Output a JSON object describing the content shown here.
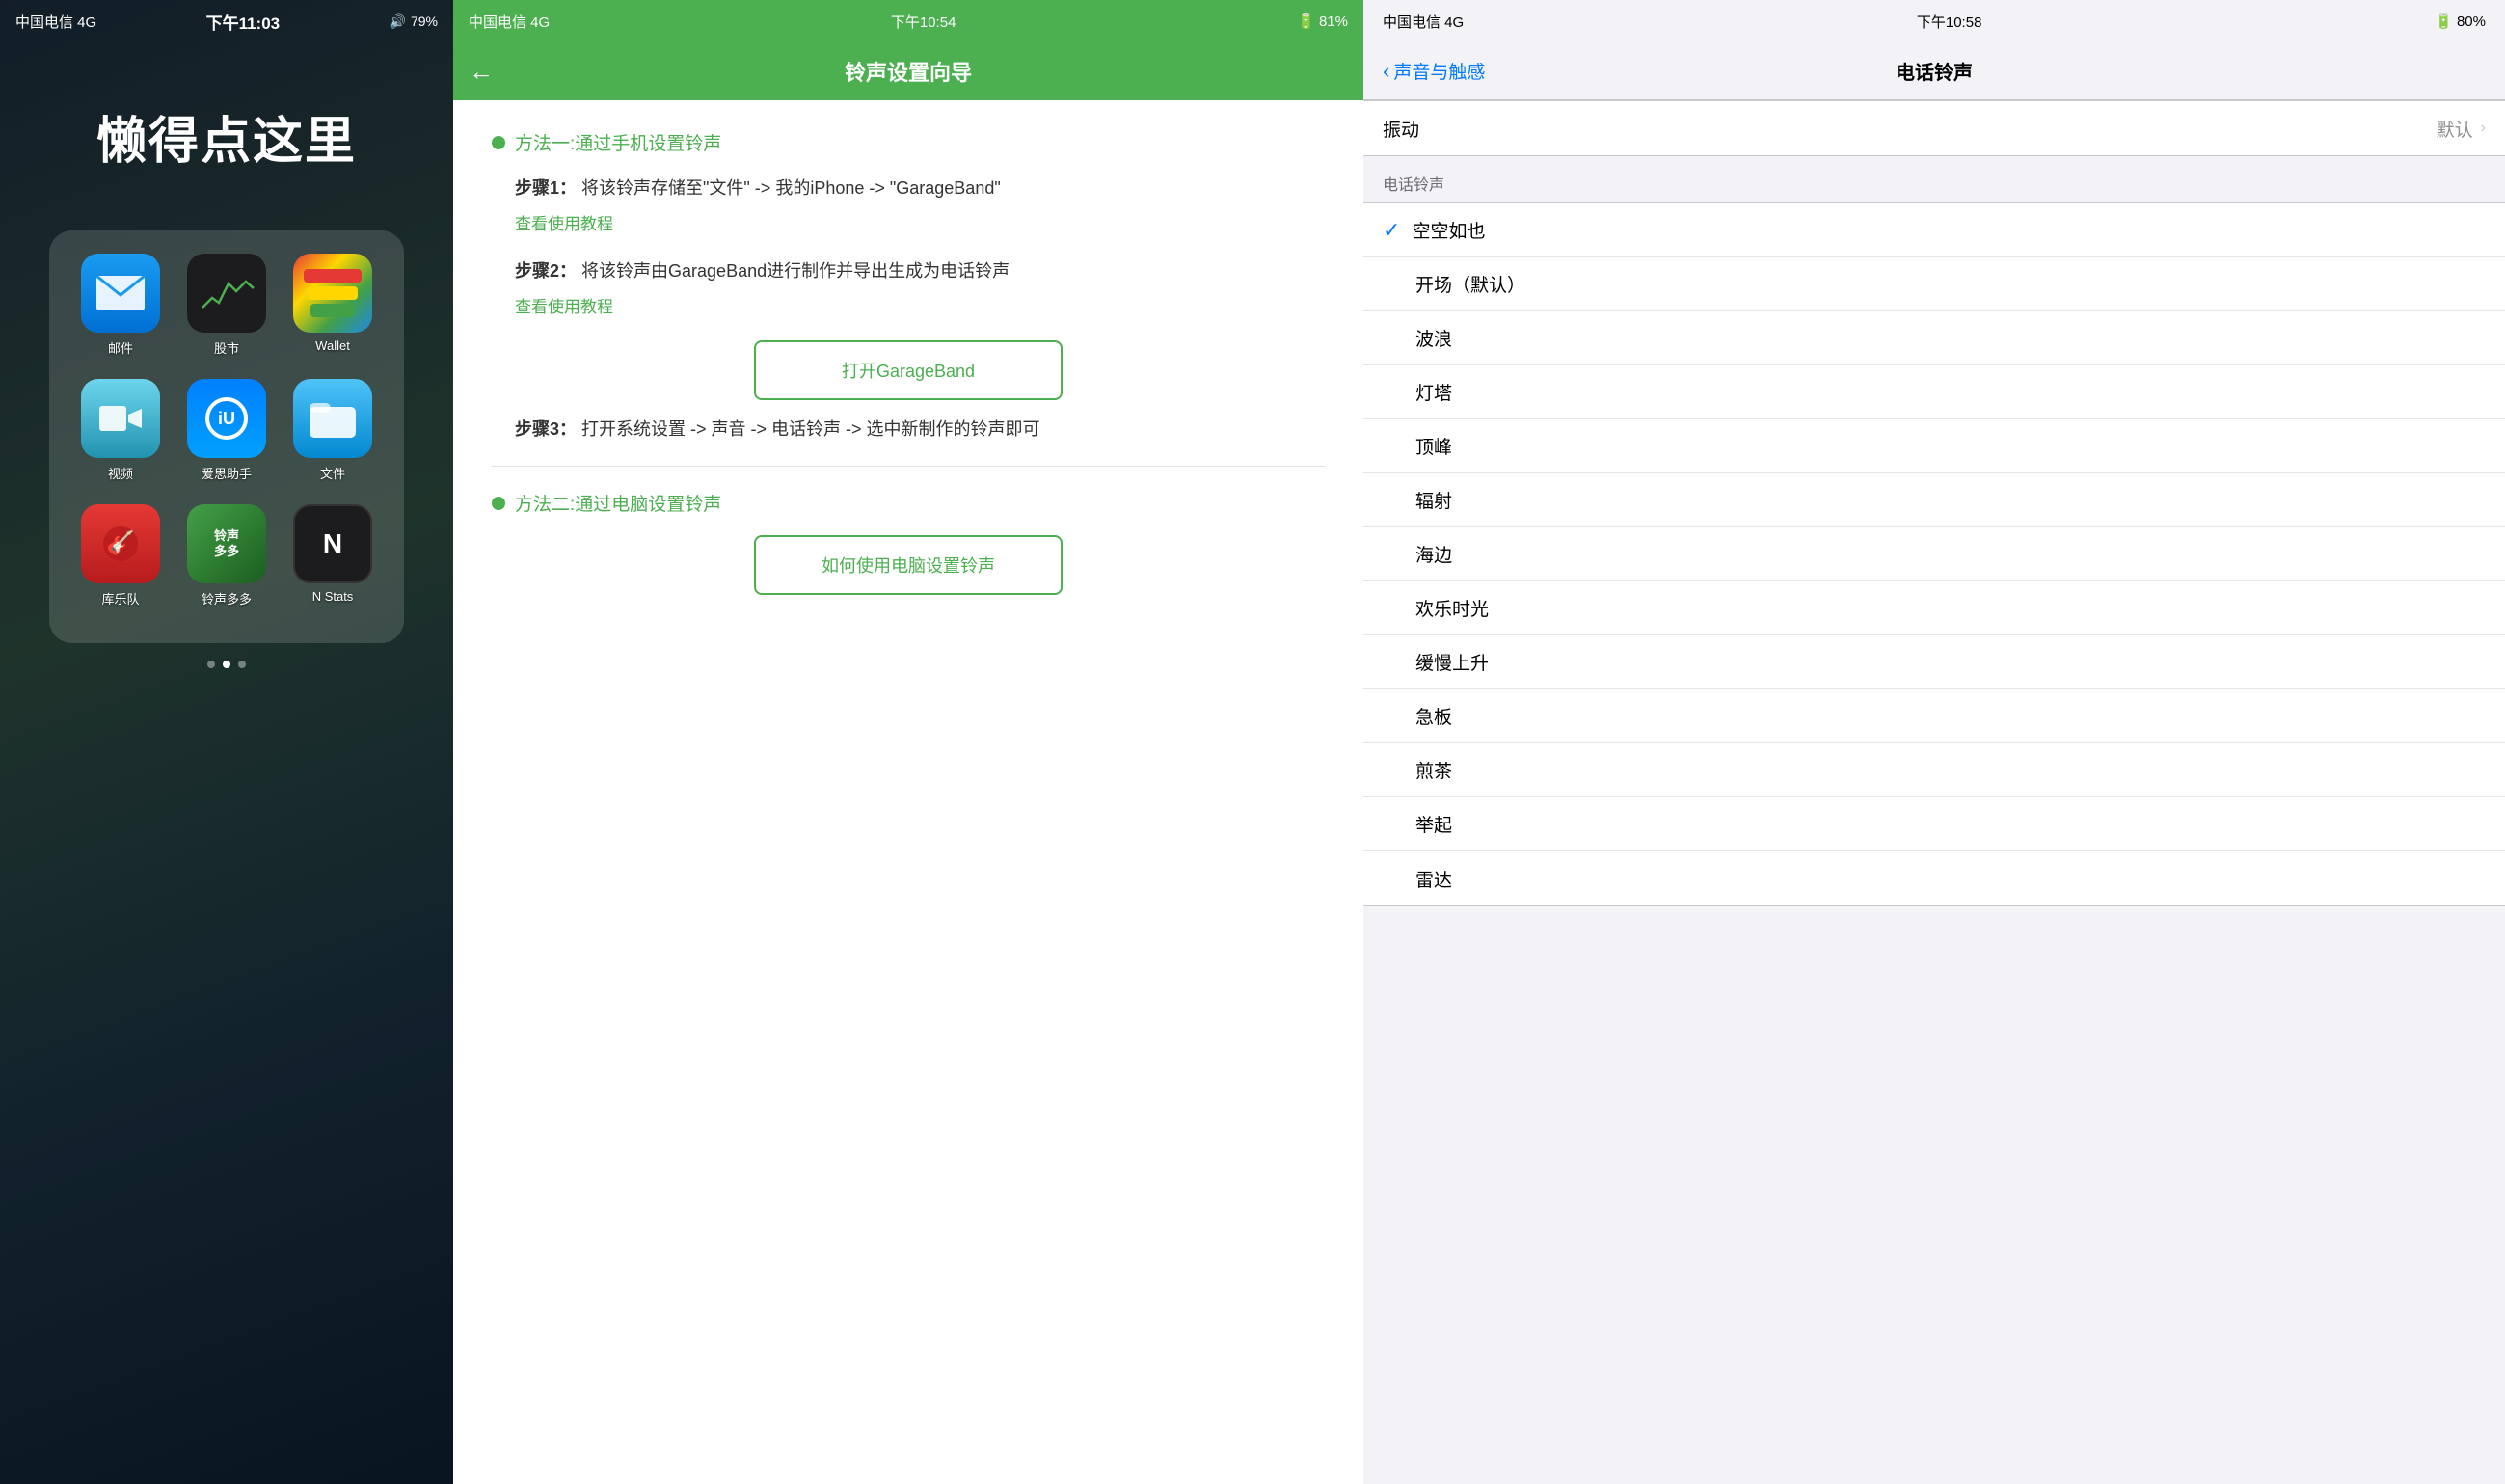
{
  "panel_home": {
    "status_bar": {
      "carrier": "中国电信",
      "network": "4G",
      "time": "下午11:03",
      "battery_pct": 79
    },
    "title": "懒得点这里",
    "apps": [
      {
        "id": "mail",
        "label": "邮件",
        "icon_type": "mail"
      },
      {
        "id": "stocks",
        "label": "股市",
        "icon_type": "stocks"
      },
      {
        "id": "wallet",
        "label": "Wallet",
        "icon_type": "wallet"
      },
      {
        "id": "video",
        "label": "视频",
        "icon_type": "video"
      },
      {
        "id": "iyunu",
        "label": "爱思助手",
        "icon_type": "iyunu"
      },
      {
        "id": "files",
        "label": "文件",
        "icon_type": "files"
      },
      {
        "id": "garageband",
        "label": "库乐队",
        "icon_type": "garageband"
      },
      {
        "id": "ringtone",
        "label": "铃声多多",
        "icon_type": "ringtone"
      },
      {
        "id": "nstats",
        "label": "N Stats",
        "icon_type": "nstats"
      }
    ],
    "dots": [
      false,
      true,
      false
    ]
  },
  "panel_guide": {
    "status_bar": {
      "carrier": "中国电信",
      "network": "4G",
      "time": "下午10:54",
      "battery_pct": 81
    },
    "title": "铃声设置向导",
    "method1_title": "方法一:通过手机设置铃声",
    "step1_label": "步骤1：",
    "step1_text": "将该铃声存储至\"文件\" -> 我的iPhone -> \"GarageBand\"",
    "step1_link": "查看使用教程",
    "step2_label": "步骤2：",
    "step2_text": "将该铃声由GarageBand进行制作并导出生成为电话铃声",
    "step2_link": "查看使用教程",
    "open_garageband_btn": "打开GarageBand",
    "step3_label": "步骤3：",
    "step3_text": "打开系统设置 -> 声音 -> 电话铃声 -> 选中新制作的铃声即可",
    "method2_title": "方法二:通过电脑设置铃声",
    "how_to_use_pc_btn": "如何使用电脑设置铃声"
  },
  "panel_settings": {
    "status_bar": {
      "carrier": "中国电信",
      "network": "4G",
      "time": "下午10:58",
      "battery_pct": 80
    },
    "back_label": "声音与触感",
    "title": "电话铃声",
    "vibrate_label": "振动",
    "vibrate_value": "默认",
    "section_label": "电话铃声",
    "ringtones": [
      {
        "id": "kongkong",
        "name": "空空如也",
        "selected": true
      },
      {
        "id": "kaichang",
        "name": "开场（默认）",
        "selected": false
      },
      {
        "id": "bolang",
        "name": "波浪",
        "selected": false
      },
      {
        "id": "dengta",
        "name": "灯塔",
        "selected": false
      },
      {
        "id": "dingfeng",
        "name": "顶峰",
        "selected": false
      },
      {
        "id": "fushe",
        "name": "辐射",
        "selected": false
      },
      {
        "id": "haibian",
        "name": "海边",
        "selected": false
      },
      {
        "id": "kuaile",
        "name": "欢乐时光",
        "selected": false
      },
      {
        "id": "huanman",
        "name": "缓慢上升",
        "selected": false
      },
      {
        "id": "jiban",
        "name": "急板",
        "selected": false
      },
      {
        "id": "jiancha",
        "name": "煎茶",
        "selected": false
      },
      {
        "id": "juqi",
        "name": "举起",
        "selected": false
      },
      {
        "id": "leida",
        "name": "雷达",
        "selected": false
      }
    ]
  }
}
